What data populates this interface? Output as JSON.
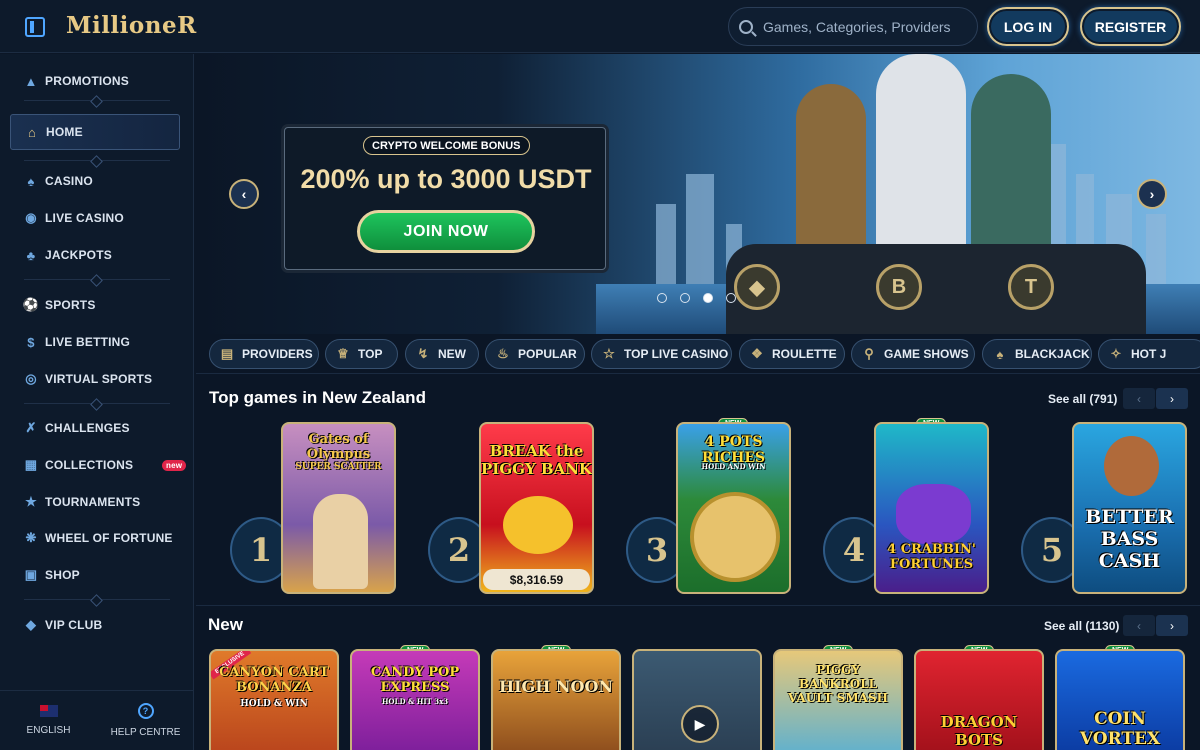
{
  "header": {
    "logo": "MillioneR",
    "search_placeholder": "Games, Categories, Providers",
    "login": "LOG IN",
    "register": "REGISTER"
  },
  "sidebar": {
    "items": [
      {
        "label": "PROMOTIONS",
        "icon": "megaphone-icon"
      },
      {
        "label": "HOME",
        "icon": "home-icon",
        "active": true
      },
      {
        "label": "CASINO",
        "icon": "casino-chip-icon"
      },
      {
        "label": "LIVE CASINO",
        "icon": "live-casino-icon"
      },
      {
        "label": "JACKPOTS",
        "icon": "clover-icon"
      },
      {
        "label": "SPORTS",
        "icon": "ball-icon"
      },
      {
        "label": "LIVE BETTING",
        "icon": "dollar-icon"
      },
      {
        "label": "VIRTUAL SPORTS",
        "icon": "globe-icon"
      },
      {
        "label": "CHALLENGES",
        "icon": "swords-icon"
      },
      {
        "label": "COLLECTIONS",
        "icon": "collections-icon",
        "badge": "new"
      },
      {
        "label": "TOURNAMENTS",
        "icon": "trophy-icon"
      },
      {
        "label": "WHEEL OF FORTUNE",
        "icon": "wheel-icon"
      },
      {
        "label": "SHOP",
        "icon": "shop-icon"
      },
      {
        "label": "VIP CLUB",
        "icon": "diamond-icon"
      }
    ],
    "footer": {
      "language": "ENGLISH",
      "help": "HELP CENTRE"
    }
  },
  "banner": {
    "label": "CRYPTO WELCOME BONUS",
    "title": "200% up to 3000 USDT",
    "cta": "JOIN NOW",
    "slides": 4,
    "active_slide": 3
  },
  "categories": [
    {
      "label": "PROVIDERS",
      "icon": "book-icon"
    },
    {
      "label": "TOP",
      "icon": "crown-icon"
    },
    {
      "label": "NEW",
      "icon": "lightning-icon"
    },
    {
      "label": "POPULAR",
      "icon": "fire-icon"
    },
    {
      "label": "TOP LIVE CASINO",
      "icon": "star-icon"
    },
    {
      "label": "ROULETTE",
      "icon": "roulette-icon"
    },
    {
      "label": "GAME SHOWS",
      "icon": "microphone-icon"
    },
    {
      "label": "BLACKJACK",
      "icon": "cards-icon"
    },
    {
      "label": "HOT J",
      "icon": "pepper-icon"
    }
  ],
  "top_games": {
    "title": "Top games in New Zealand",
    "see_all": "See all (791)",
    "games": [
      {
        "rank": "1",
        "title": "Gates of Olympus",
        "subtitle": "SUPER SCATTER",
        "tag": ""
      },
      {
        "rank": "2",
        "title": "BREAK the PIGGY BANK",
        "jackpot": "$8,316.59",
        "tag": ""
      },
      {
        "rank": "3",
        "title": "4 POTS RICHES",
        "subtitle": "HOLD AND WIN",
        "tag": "NEW"
      },
      {
        "rank": "4",
        "title": "4 CRABBIN' FORTUNES",
        "tag": "NEW"
      },
      {
        "rank": "5",
        "title": "BETTER BASS CASH",
        "tag": ""
      }
    ]
  },
  "new_games": {
    "title": "New",
    "see_all": "See all (1130)",
    "games": [
      {
        "title": "CANYON CART BONANZA",
        "subtitle": "HOLD & WIN",
        "tag": "EXCLUSIVE"
      },
      {
        "title": "CANDY POP EXPRESS",
        "subtitle": "HOLD & HIT 3x3",
        "tag": "NEW"
      },
      {
        "title": "HIGH NOON",
        "tag": "NEW"
      },
      {
        "title": "",
        "tag": ""
      },
      {
        "title": "PIGGY BANKROLL VAULT SMASH",
        "tag": "NEW"
      },
      {
        "title": "DRAGON BOTS",
        "tag": "NEW"
      },
      {
        "title": "COIN VORTEX",
        "tag": "NEW"
      }
    ]
  }
}
